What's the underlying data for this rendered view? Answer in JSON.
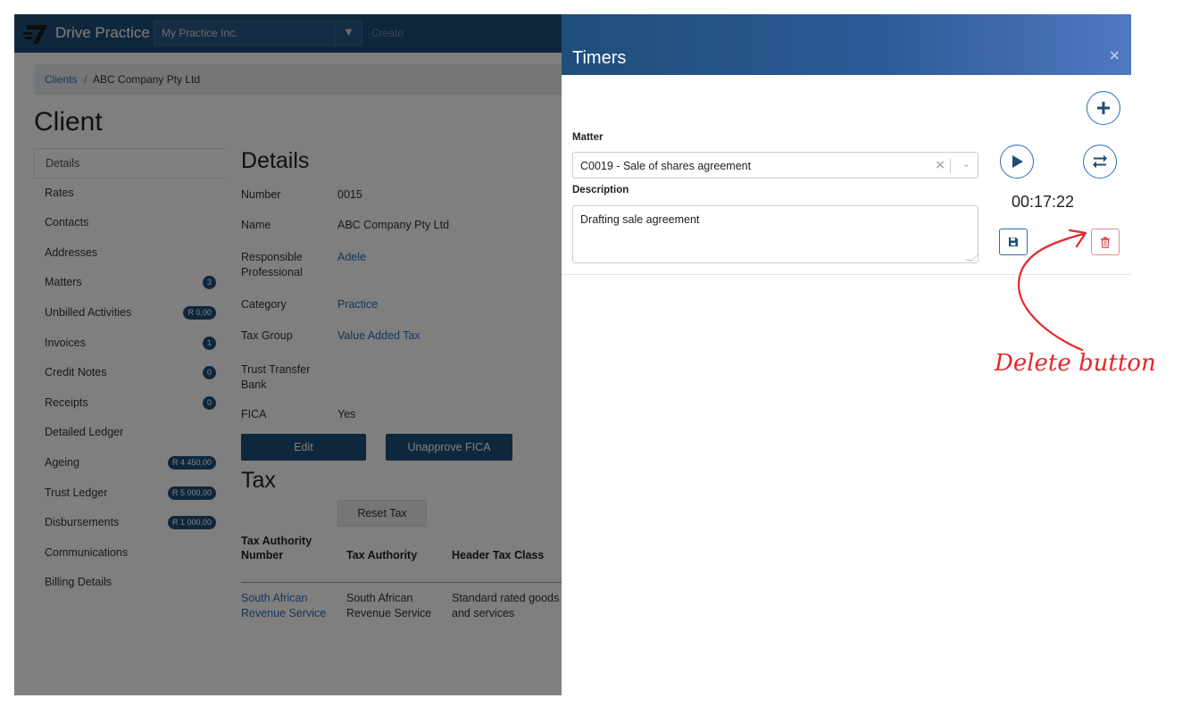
{
  "app": {
    "brand": "Drive Practice",
    "firm_selector": "My Practice Inc.",
    "create_label": "Create"
  },
  "breadcrumb": {
    "parent": "Clients",
    "separator": "/",
    "current": "ABC Company Pty Ltd"
  },
  "page_title": "Client",
  "side_nav": [
    {
      "label": "Details",
      "active": true,
      "badge": ""
    },
    {
      "label": "Rates",
      "badge": ""
    },
    {
      "label": "Contacts",
      "badge": ""
    },
    {
      "label": "Addresses",
      "badge": ""
    },
    {
      "label": "Matters",
      "badge": "3"
    },
    {
      "label": "Unbilled Activities",
      "badge": "R 0,00"
    },
    {
      "label": "Invoices",
      "badge": "1"
    },
    {
      "label": "Credit Notes",
      "badge": "0"
    },
    {
      "label": "Receipts",
      "badge": "0"
    },
    {
      "label": "Detailed Ledger",
      "badge": ""
    },
    {
      "label": "Ageing",
      "badge": "R 4 450,00"
    },
    {
      "label": "Trust Ledger",
      "badge": "R 5 000,00"
    },
    {
      "label": "Disbursements",
      "badge": "R 1 000,00"
    },
    {
      "label": "Communications",
      "badge": ""
    },
    {
      "label": "Billing Details",
      "badge": ""
    }
  ],
  "details": {
    "title": "Details",
    "rows": [
      {
        "label": "Number",
        "value": "0015",
        "link": false
      },
      {
        "label": "Name",
        "value": "ABC Company Pty Ltd",
        "link": false
      },
      {
        "label": "Responsible Professional",
        "value": "Adele",
        "link": true
      },
      {
        "label": "Category",
        "value": "Practice",
        "link": true
      },
      {
        "label": "Tax Group",
        "value": "Value Added Tax",
        "link": true
      },
      {
        "label": "Trust Transfer Bank",
        "value": "",
        "link": false
      },
      {
        "label": "FICA",
        "value": "Yes",
        "link": false
      }
    ],
    "edit_label": "Edit",
    "unapprove_label": "Unapprove FICA"
  },
  "tax": {
    "title": "Tax",
    "reset_label": "Reset Tax",
    "headers": [
      "Tax Authority Number",
      "Tax Authority",
      "Header Tax Class"
    ],
    "row": [
      "South African Revenue Service",
      "South African Revenue Service",
      "Standard rated goods and services"
    ]
  },
  "timers": {
    "title": "Timers",
    "close_icon": "×",
    "matter_label": "Matter",
    "matter_value": "C0019 - Sale of shares agreement",
    "description_label": "Description",
    "description_value": "Drafting sale agreement",
    "elapsed": "00:17:22",
    "icons": {
      "add": "plus-icon",
      "play": "play-icon",
      "switch": "swap-icon",
      "save": "floppy-disk-icon",
      "delete": "trash-icon"
    }
  },
  "annotation": {
    "text": "Delete button",
    "color": "#e8262a"
  },
  "colors": {
    "navy": "#1f4e79",
    "link": "#2a6db5",
    "delete_border": "#e38a92",
    "annotation": "#e8262a"
  }
}
